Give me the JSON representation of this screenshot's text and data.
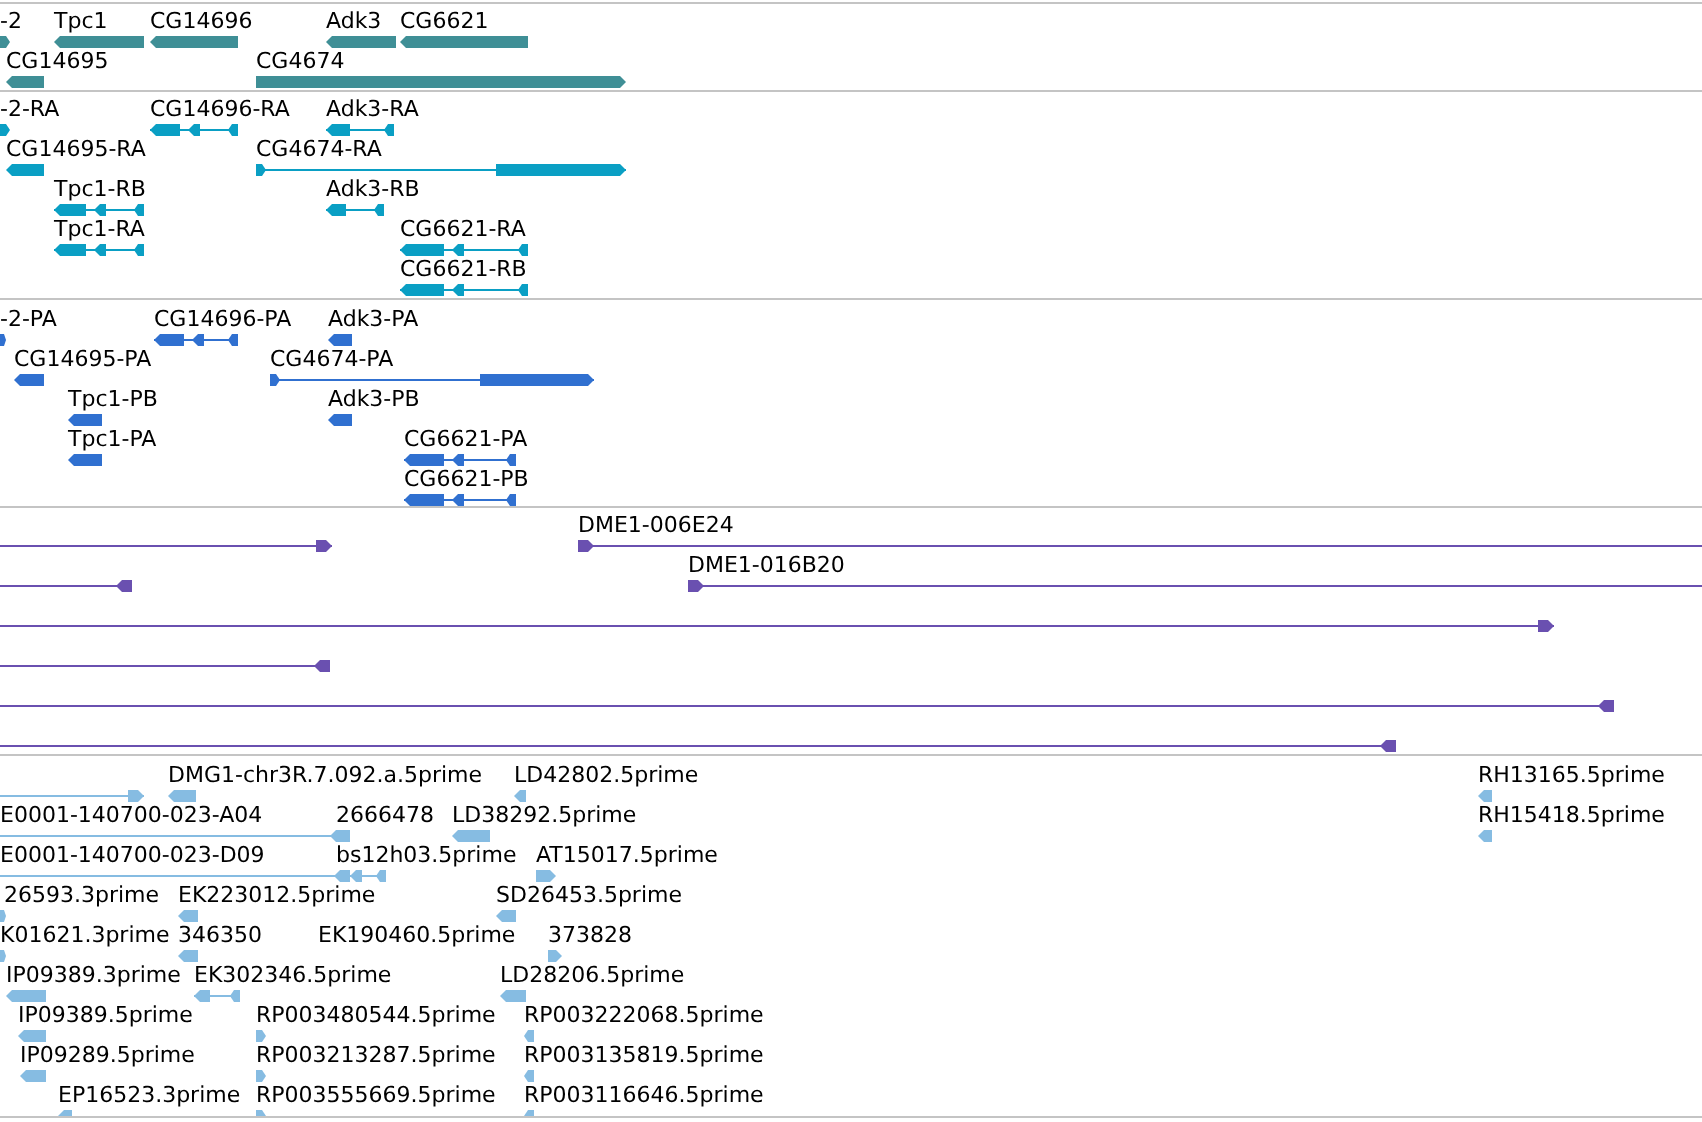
{
  "tracks": [
    {
      "color": "#3f8f96",
      "features": [
        {
          "label": "-2",
          "kind": "block",
          "reverse": false
        },
        {
          "label": "Tpc1",
          "kind": "block",
          "reverse": true
        },
        {
          "label": "CG14696",
          "kind": "block",
          "reverse": true
        },
        {
          "label": "Adk3",
          "kind": "block",
          "reverse": true
        },
        {
          "label": "CG6621",
          "kind": "block",
          "reverse": true
        },
        {
          "label": "CG14695",
          "kind": "block",
          "reverse": true
        },
        {
          "label": "CG4674",
          "kind": "block",
          "reverse": false
        }
      ]
    },
    {
      "color": "#0a9fc4",
      "features": [
        {
          "label": "-2-RA",
          "kind": "block",
          "reverse": false
        },
        {
          "label": "CG14696-RA",
          "kind": "spliced",
          "reverse": true
        },
        {
          "label": "Adk3-RA",
          "kind": "spliced",
          "reverse": true
        },
        {
          "label": "CG14695-RA",
          "kind": "block",
          "reverse": true
        },
        {
          "label": "CG4674-RA",
          "kind": "spliced",
          "reverse": false
        },
        {
          "label": "Tpc1-RB",
          "kind": "spliced",
          "reverse": true
        },
        {
          "label": "Adk3-RB",
          "kind": "spliced",
          "reverse": true
        },
        {
          "label": "Tpc1-RA",
          "kind": "spliced",
          "reverse": true
        },
        {
          "label": "CG6621-RA",
          "kind": "spliced",
          "reverse": true
        },
        {
          "label": "CG6621-RB",
          "kind": "spliced",
          "reverse": true
        }
      ]
    },
    {
      "color": "#3070d0",
      "features": [
        {
          "label": "-2-PA",
          "kind": "block",
          "reverse": false
        },
        {
          "label": "CG14696-PA",
          "kind": "spliced",
          "reverse": true
        },
        {
          "label": "Adk3-PA",
          "kind": "block",
          "reverse": true
        },
        {
          "label": "CG14695-PA",
          "kind": "block",
          "reverse": true
        },
        {
          "label": "CG4674-PA",
          "kind": "spliced",
          "reverse": false
        },
        {
          "label": "Tpc1-PB",
          "kind": "block",
          "reverse": true
        },
        {
          "label": "Adk3-PB",
          "kind": "block",
          "reverse": true
        },
        {
          "label": "Tpc1-PA",
          "kind": "block",
          "reverse": true
        },
        {
          "label": "CG6621-PA",
          "kind": "spliced",
          "reverse": true
        },
        {
          "label": "CG6621-PB",
          "kind": "spliced",
          "reverse": true
        }
      ]
    },
    {
      "color": "#6a50b0",
      "features": [
        {
          "kind": "line",
          "reverse": false
        },
        {
          "label": "DME1-006E24",
          "kind": "line",
          "reverse": false
        },
        {
          "kind": "line",
          "reverse": true
        },
        {
          "label": "DME1-016B20",
          "kind": "line",
          "reverse": false
        },
        {
          "kind": "line",
          "reverse": false
        },
        {
          "kind": "line",
          "reverse": true
        },
        {
          "kind": "line",
          "reverse": true
        },
        {
          "kind": "line",
          "reverse": true
        }
      ]
    },
    {
      "color": "#86bce2",
      "features": [
        {
          "kind": "line",
          "reverse": false
        },
        {
          "label": "DMG1-chr3R.7.092.a.5prime",
          "kind": "block",
          "reverse": true
        },
        {
          "label": "LD42802.5prime",
          "kind": "block",
          "reverse": true
        },
        {
          "label": "RH13165.5prime",
          "kind": "block",
          "reverse": true
        },
        {
          "label": "E0001-140700-023-A04",
          "kind": "line",
          "reverse": true
        },
        {
          "label": "2666478",
          "kind": "block",
          "reverse": true
        },
        {
          "label": "LD38292.5prime",
          "kind": "block",
          "reverse": true
        },
        {
          "label": "RH15418.5prime",
          "kind": "block",
          "reverse": true
        },
        {
          "label": "E0001-140700-023-D09",
          "kind": "line",
          "reverse": true
        },
        {
          "label": "bs12h03.5prime",
          "kind": "spliced",
          "reverse": true
        },
        {
          "label": "AT15017.5prime",
          "kind": "block",
          "reverse": false
        },
        {
          "label": "26593.3prime",
          "kind": "block",
          "reverse": false
        },
        {
          "label": "EK223012.5prime",
          "kind": "block",
          "reverse": true
        },
        {
          "label": "SD26453.5prime",
          "kind": "block",
          "reverse": true
        },
        {
          "label": "K01621.3prime",
          "kind": "block",
          "reverse": false
        },
        {
          "label": "346350",
          "kind": "block",
          "reverse": true
        },
        {
          "label": "EK190460.5prime"
        },
        {
          "label": "373828",
          "kind": "block",
          "reverse": false
        },
        {
          "label": "IP09389.3prime",
          "kind": "block",
          "reverse": true
        },
        {
          "label": "EK302346.5prime",
          "kind": "spliced",
          "reverse": true
        },
        {
          "label": "LD28206.5prime",
          "kind": "block",
          "reverse": true
        },
        {
          "label": "IP09389.5prime",
          "kind": "block",
          "reverse": true
        },
        {
          "label": "RP003480544.5prime",
          "kind": "block",
          "reverse": false
        },
        {
          "label": "RP003222068.5prime",
          "kind": "block",
          "reverse": true
        },
        {
          "label": "IP09289.5prime",
          "kind": "block",
          "reverse": true
        },
        {
          "label": "RP003213287.5prime",
          "kind": "block",
          "reverse": false
        },
        {
          "label": "RP003135819.5prime",
          "kind": "block",
          "reverse": true
        },
        {
          "label": "EP16523.3prime",
          "kind": "block",
          "reverse": true
        },
        {
          "label": "RP003555669.5prime",
          "kind": "block",
          "reverse": false
        },
        {
          "label": "RP003116646.5prime",
          "kind": "block",
          "reverse": true
        }
      ]
    }
  ]
}
